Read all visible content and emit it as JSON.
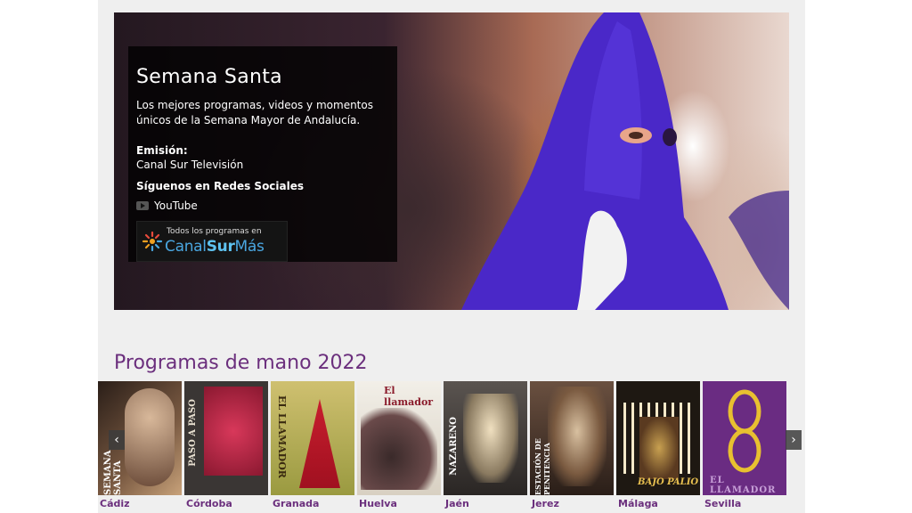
{
  "hero": {
    "title": "Semana Santa",
    "description": "Los mejores programas, videos y momentos únicos de la Semana Mayor de Andalucía.",
    "emision_label": "Emisión:",
    "emision_value": "Canal Sur Televisión",
    "social_label": "Síguenos en Redes Sociales",
    "youtube_label": "YouTube",
    "canalsur_small": "Todos los programas en",
    "canalsur_brand_a": "Canal",
    "canalsur_brand_b": "Sur",
    "canalsur_brand_c": "Más"
  },
  "programs": {
    "title": "Programas de mano 2022",
    "prev_label": "‹",
    "next_label": "›",
    "items": [
      {
        "city": "Cádiz",
        "cover_text": "SEMANA SANTA",
        "color": "#5a4436"
      },
      {
        "city": "Córdoba",
        "cover_text": "PASO A PASO",
        "color": "#4a3a35"
      },
      {
        "city": "Granada",
        "cover_text": "EL LLAMADOR",
        "color": "#8a7a3a"
      },
      {
        "city": "Huelva",
        "cover_text": "El llamador",
        "color": "#e8e4dc"
      },
      {
        "city": "Jaén",
        "cover_text": "NAZARENO",
        "color": "#3b3b3b"
      },
      {
        "city": "Jerez",
        "cover_text": "ESTACIÓN DE PENITENCIA",
        "color": "#4a3a2e"
      },
      {
        "city": "Málaga",
        "cover_text": "BAJO PALIO",
        "color": "#2a2018"
      },
      {
        "city": "Sevilla",
        "cover_text": "EL LLAMADOR",
        "color": "#6a2c82"
      }
    ]
  }
}
